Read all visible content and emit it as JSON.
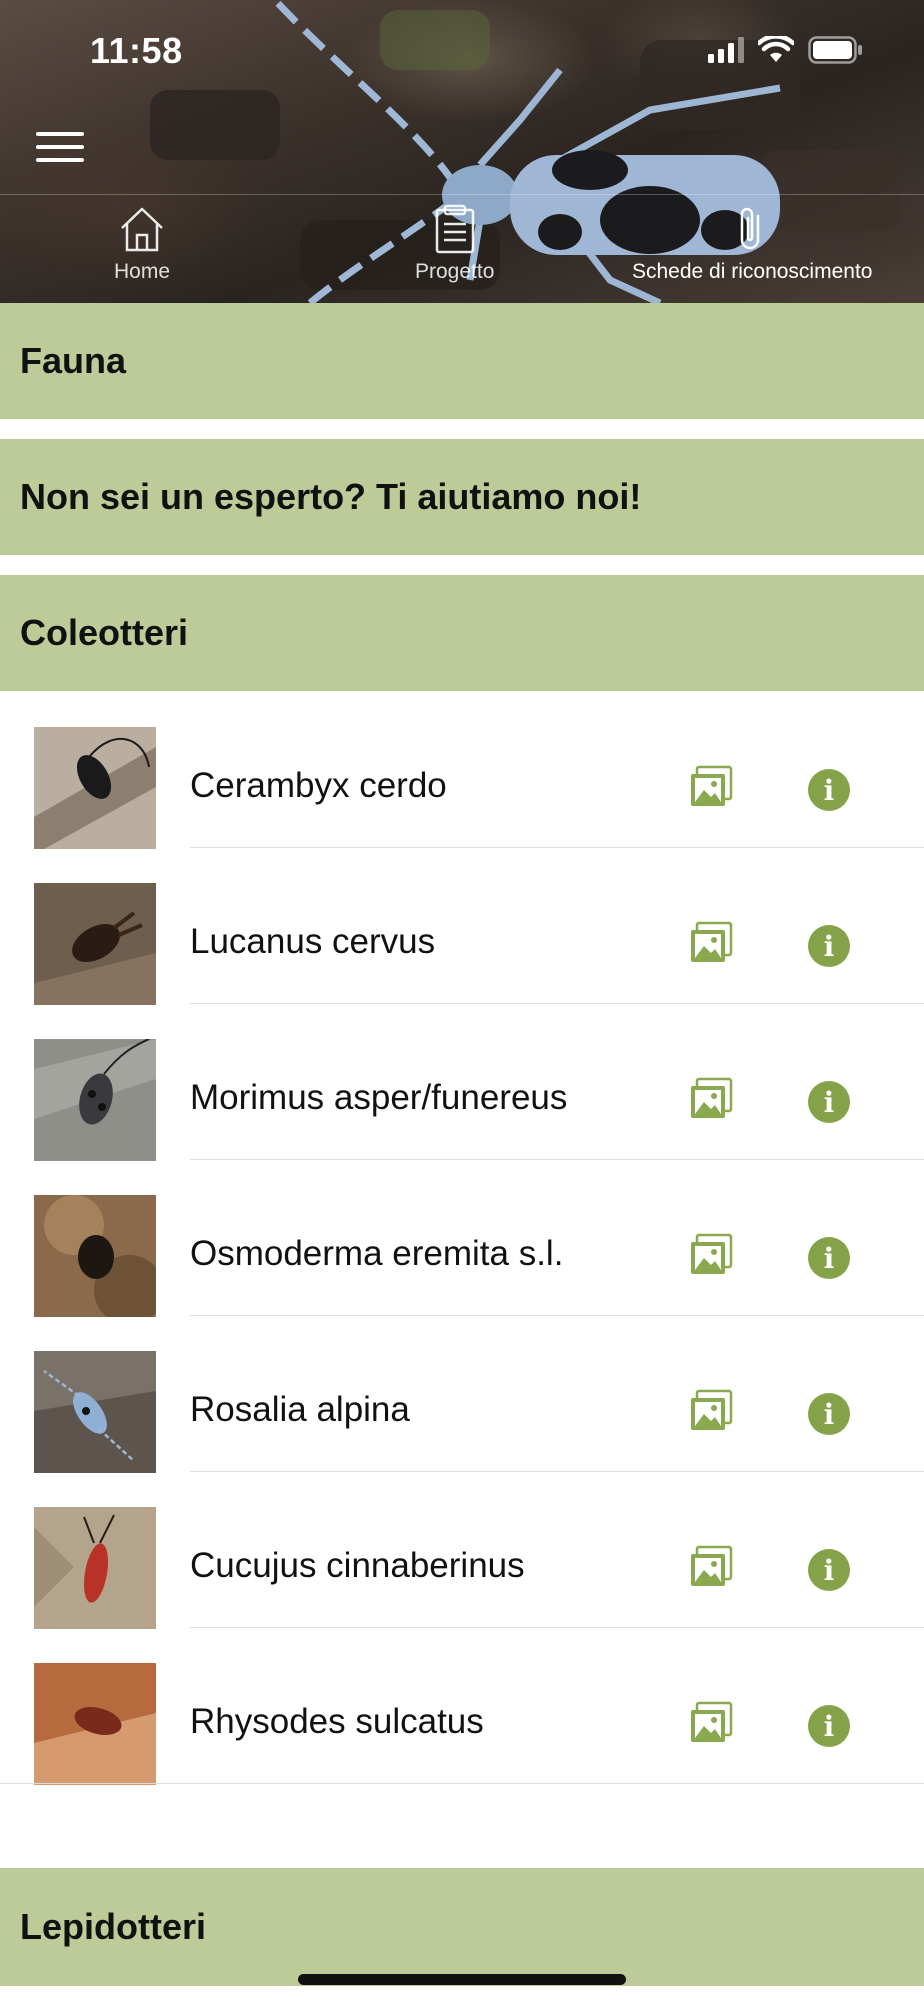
{
  "status_bar": {
    "time": "11:58"
  },
  "nav": {
    "tabs": [
      {
        "label": "Home",
        "icon": "home-icon"
      },
      {
        "label": "Progetto",
        "icon": "document-icon"
      },
      {
        "label": "Schede di riconoscimento",
        "icon": "paperclip-icon"
      }
    ],
    "active_tab": "Schede di riconoscimento"
  },
  "sections": {
    "fauna": "Fauna",
    "help": "Non sei un esperto? Ti aiutiamo noi!",
    "coleotteri": "Coleotteri",
    "lepidotteri": "Lepidotteri"
  },
  "species": [
    {
      "name": "Cerambyx cerdo"
    },
    {
      "name": "Lucanus cervus"
    },
    {
      "name": "Morimus asper/funereus"
    },
    {
      "name": "Osmoderma eremita s.l."
    },
    {
      "name": "Rosalia alpina"
    },
    {
      "name": "Cucujus cinnaberinus"
    },
    {
      "name": "Rhysodes sulcatus"
    }
  ],
  "row_icons": {
    "gallery": "image-gallery-icon",
    "info": "info-icon",
    "info_glyph": "i"
  },
  "colors": {
    "accent_green": "#85a248",
    "section_green": "#bccb98",
    "gallery_green": "#8aa84f"
  }
}
